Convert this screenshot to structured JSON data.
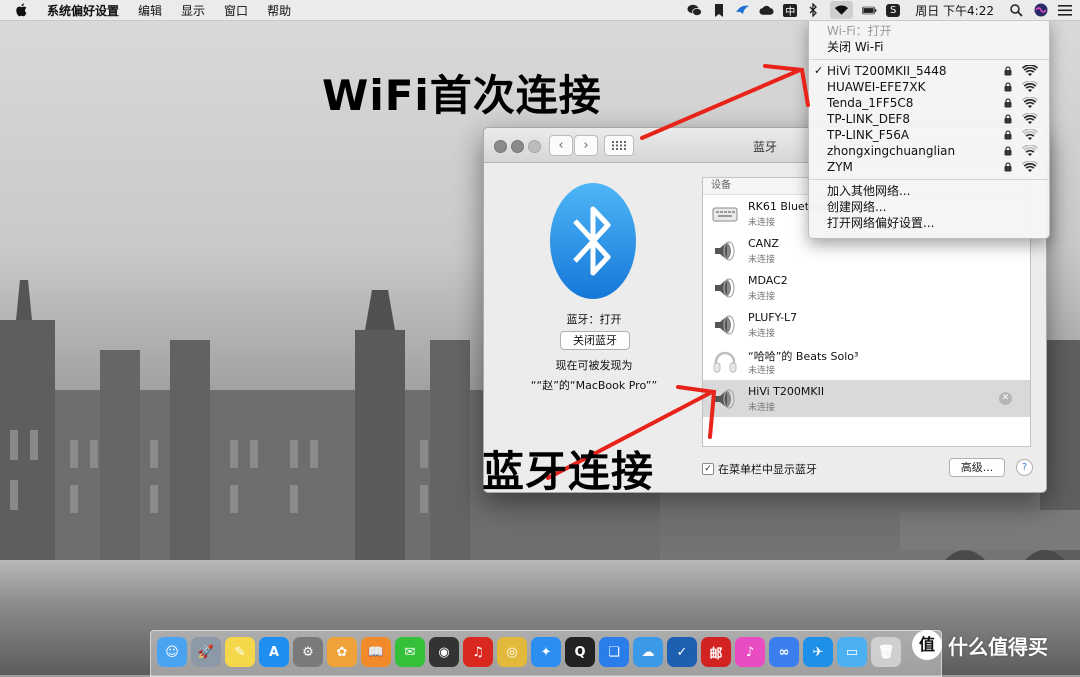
{
  "menubar": {
    "app_name": "系统偏好设置",
    "menus": [
      "编辑",
      "显示",
      "窗口",
      "帮助"
    ],
    "clock": "周日 下午4:22",
    "status_icons": [
      "wechat-icon",
      "bookmark-icon",
      "bird-icon",
      "cloud-icon",
      "input-zh-icon",
      "bluetooth-icon",
      "wifi-icon",
      "battery-icon",
      "s-app-icon",
      "search-icon",
      "siri-icon",
      "list-icon"
    ]
  },
  "wifi_menu": {
    "status": "Wi-Fi：打开",
    "toggle": "关闭 Wi-Fi",
    "networks": [
      {
        "name": "HiVi T200MKII_5448",
        "checked": true,
        "locked": true,
        "strength": 4
      },
      {
        "name": "HUAWEI-EFE7XK",
        "checked": false,
        "locked": true,
        "strength": 3
      },
      {
        "name": "Tenda_1FF5C8",
        "checked": false,
        "locked": true,
        "strength": 3
      },
      {
        "name": "TP-LINK_DEF8",
        "checked": false,
        "locked": true,
        "strength": 3
      },
      {
        "name": "TP-LINK_F56A",
        "checked": false,
        "locked": true,
        "strength": 2
      },
      {
        "name": "zhongxingchuanglian",
        "checked": false,
        "locked": true,
        "strength": 2
      },
      {
        "name": "ZYM",
        "checked": false,
        "locked": true,
        "strength": 3
      }
    ],
    "actions": [
      "加入其他网络...",
      "创建网络...",
      "打开网络偏好设置..."
    ]
  },
  "bt_window": {
    "title": "蓝牙",
    "status": "蓝牙：打开",
    "toggle_button": "关闭蓝牙",
    "discoverable_line1": "现在可被发现为",
    "discoverable_line2": "““赵”的“MacBook Pro””",
    "devices_header": "设备",
    "devices": [
      {
        "name": "RK61 Bluetooth",
        "status": "未连接",
        "icon": "keyboard-icon"
      },
      {
        "name": "CANZ",
        "status": "未连接",
        "icon": "speaker-icon"
      },
      {
        "name": "MDAC2",
        "status": "未连接",
        "icon": "speaker-icon"
      },
      {
        "name": "PLUFY-L7",
        "status": "未连接",
        "icon": "speaker-icon"
      },
      {
        "name": "“哈哈”的 Beats Solo³",
        "status": "未连接",
        "icon": "headphones-icon"
      },
      {
        "name": "HiVi T200MKII",
        "status": "未连接",
        "icon": "speaker-icon",
        "selected": true
      }
    ],
    "show_in_menubar_label": "在菜单栏中显示蓝牙",
    "show_in_menubar_checked": true,
    "advanced_button": "高级...",
    "help_button": "?"
  },
  "annotations": {
    "wifi_label": "WiFi首次连接",
    "bt_label": "蓝牙连接",
    "arrow_color": "#e8231a"
  },
  "dock": {
    "apps": [
      {
        "icon": "finder-icon",
        "color": "#4aa3f0",
        "glyph": "☺"
      },
      {
        "icon": "launchpad-icon",
        "color": "#8c9aa8",
        "glyph": "🚀"
      },
      {
        "icon": "notes-icon",
        "color": "#f5d84a",
        "glyph": "✎"
      },
      {
        "icon": "appstore-icon",
        "color": "#1f8ef1",
        "glyph": "A"
      },
      {
        "icon": "system-preferences-icon",
        "color": "#7a7a7a",
        "glyph": "⚙"
      },
      {
        "icon": "photos-icon",
        "color": "#f0a23a",
        "glyph": "✿"
      },
      {
        "icon": "ibooks-icon",
        "color": "#f08a2a",
        "glyph": "📖"
      },
      {
        "icon": "wechat-icon",
        "color": "#35c03a",
        "glyph": "✉"
      },
      {
        "icon": "speaker-app-icon",
        "color": "#333333",
        "glyph": "◉"
      },
      {
        "icon": "netease-music-icon",
        "color": "#d8281f",
        "glyph": "♫"
      },
      {
        "icon": "chrome-icon",
        "color": "#e2b93b",
        "glyph": "◎"
      },
      {
        "icon": "safari-icon",
        "color": "#2c8ef0",
        "glyph": "✦"
      },
      {
        "icon": "qq-icon",
        "color": "#222222",
        "glyph": "Q"
      },
      {
        "icon": "bookmark-app-icon",
        "color": "#2b7de9",
        "glyph": "❏"
      },
      {
        "icon": "cloud-app-icon",
        "color": "#3b9ae8",
        "glyph": "☁"
      },
      {
        "icon": "tasks-icon",
        "color": "#1d5fb0",
        "glyph": "✓"
      },
      {
        "icon": "mail-app-icon",
        "color": "#d32222",
        "glyph": "邮"
      },
      {
        "icon": "itunes-icon",
        "color": "#e94cc0",
        "glyph": "♪"
      },
      {
        "icon": "baidu-netdisk-icon",
        "color": "#3b7ef0",
        "glyph": "∞"
      },
      {
        "icon": "feishu-icon",
        "color": "#1e90e8",
        "glyph": "✈"
      },
      {
        "icon": "folder-icon",
        "color": "#4bb0f0",
        "glyph": "▭"
      },
      {
        "icon": "trash-icon",
        "color": "#cfcfcf",
        "glyph": "🗑"
      }
    ]
  },
  "watermark": {
    "text": "什么值得买",
    "logo_glyph": "值"
  }
}
